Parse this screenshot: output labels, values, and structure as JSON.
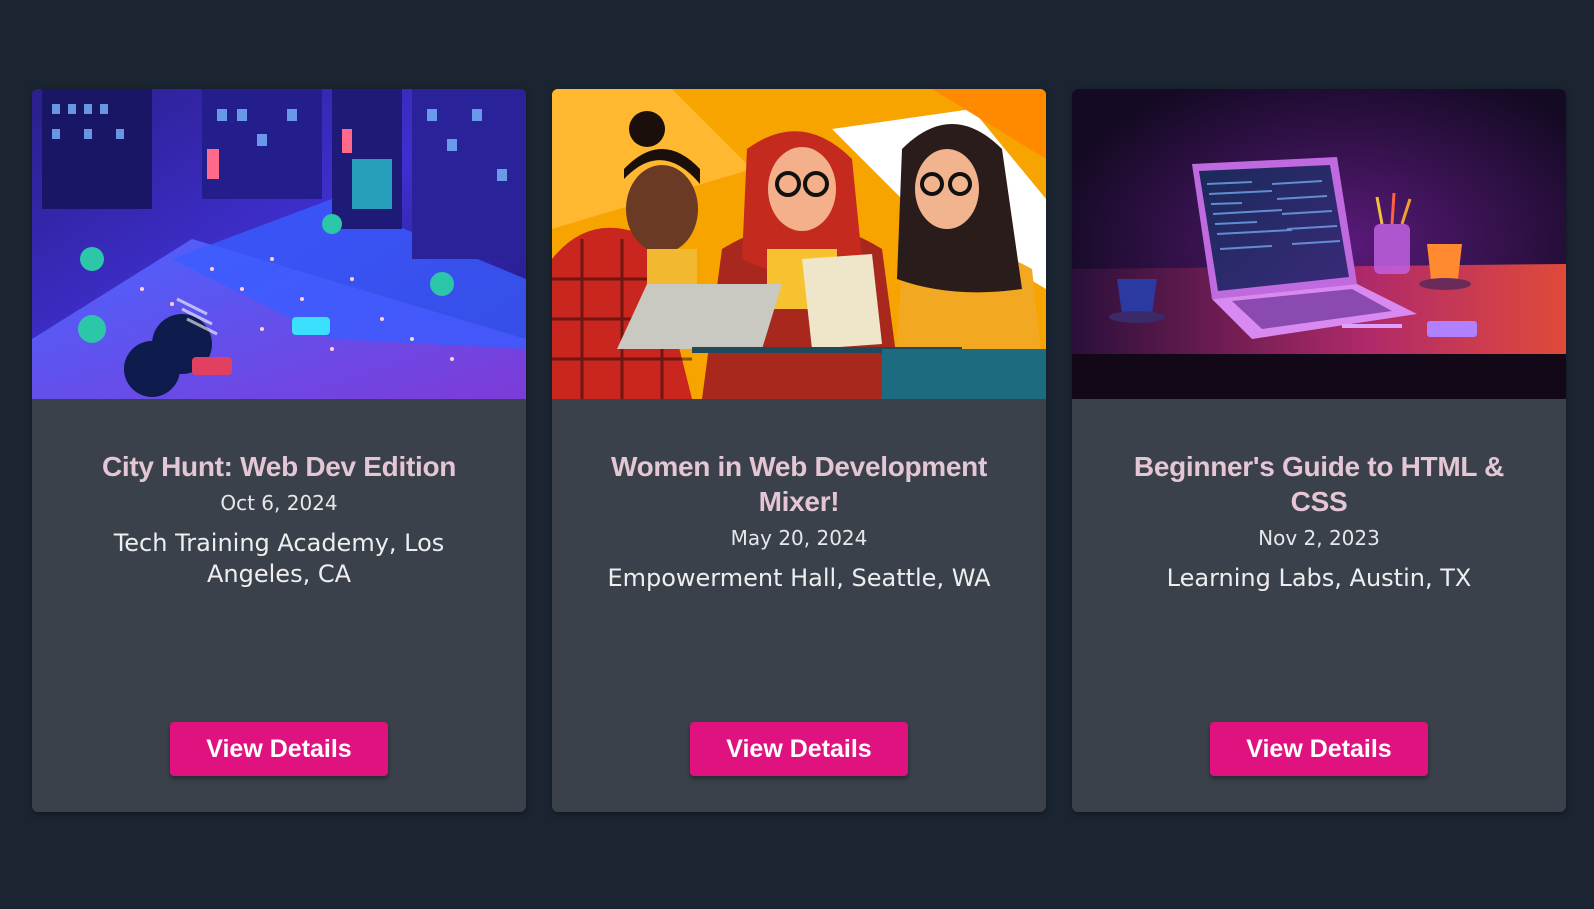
{
  "events": [
    {
      "title": "City Hunt: Web Dev Edition",
      "date": "Oct 6, 2024",
      "venue": "Tech Training Academy, Los Angeles, CA",
      "button_label": "View Details",
      "image": "isometric-city-crowd-illustration"
    },
    {
      "title": "Women in Web Development Mixer!",
      "date": "May 20, 2024",
      "venue": "Empowerment Hall, Seattle, WA",
      "button_label": "View Details",
      "image": "three-women-with-laptops-illustration"
    },
    {
      "title": "Beginner's Guide to HTML & CSS",
      "date": "Nov 2, 2023",
      "venue": "Learning Labs, Austin, TX",
      "button_label": "View Details",
      "image": "laptop-on-desk-neon-illustration"
    }
  ],
  "colors": {
    "page_background": "#1b2431",
    "card_background": "#3a414b",
    "title": "#e4c6d4",
    "button": "#e0127f"
  }
}
